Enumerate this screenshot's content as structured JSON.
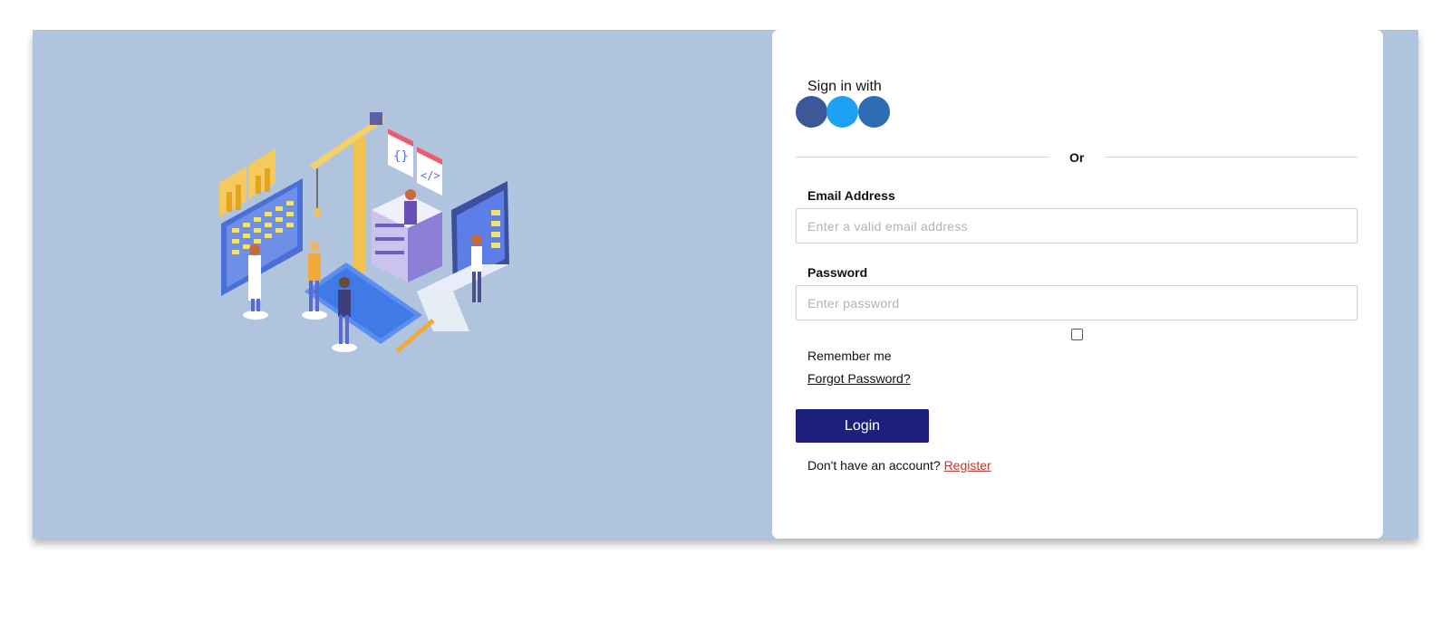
{
  "illustration": {
    "description_icon": "isometric-developers-illustration-icon"
  },
  "signin": {
    "label": "Sign in with",
    "social": [
      {
        "name": "facebook-icon",
        "color": "#3b5998"
      },
      {
        "name": "twitter-icon",
        "color": "#1da1f2"
      },
      {
        "name": "linkedin-icon",
        "color": "#2d6db5"
      }
    ]
  },
  "divider": {
    "text": "Or"
  },
  "email": {
    "label": "Email Address",
    "placeholder": "Enter a valid email address",
    "value": ""
  },
  "password": {
    "label": "Password",
    "placeholder": "Enter password",
    "value": ""
  },
  "remember": {
    "label": "Remember me",
    "checked": false
  },
  "forgot": {
    "label": "Forgot Password?"
  },
  "login": {
    "label": "Login",
    "color": "#1c207c"
  },
  "register": {
    "prompt": "Don't have an account?",
    "link": "Register",
    "link_color": "#c0392b"
  },
  "colors": {
    "background": "#b0c4de",
    "panel": "#ffffff"
  }
}
